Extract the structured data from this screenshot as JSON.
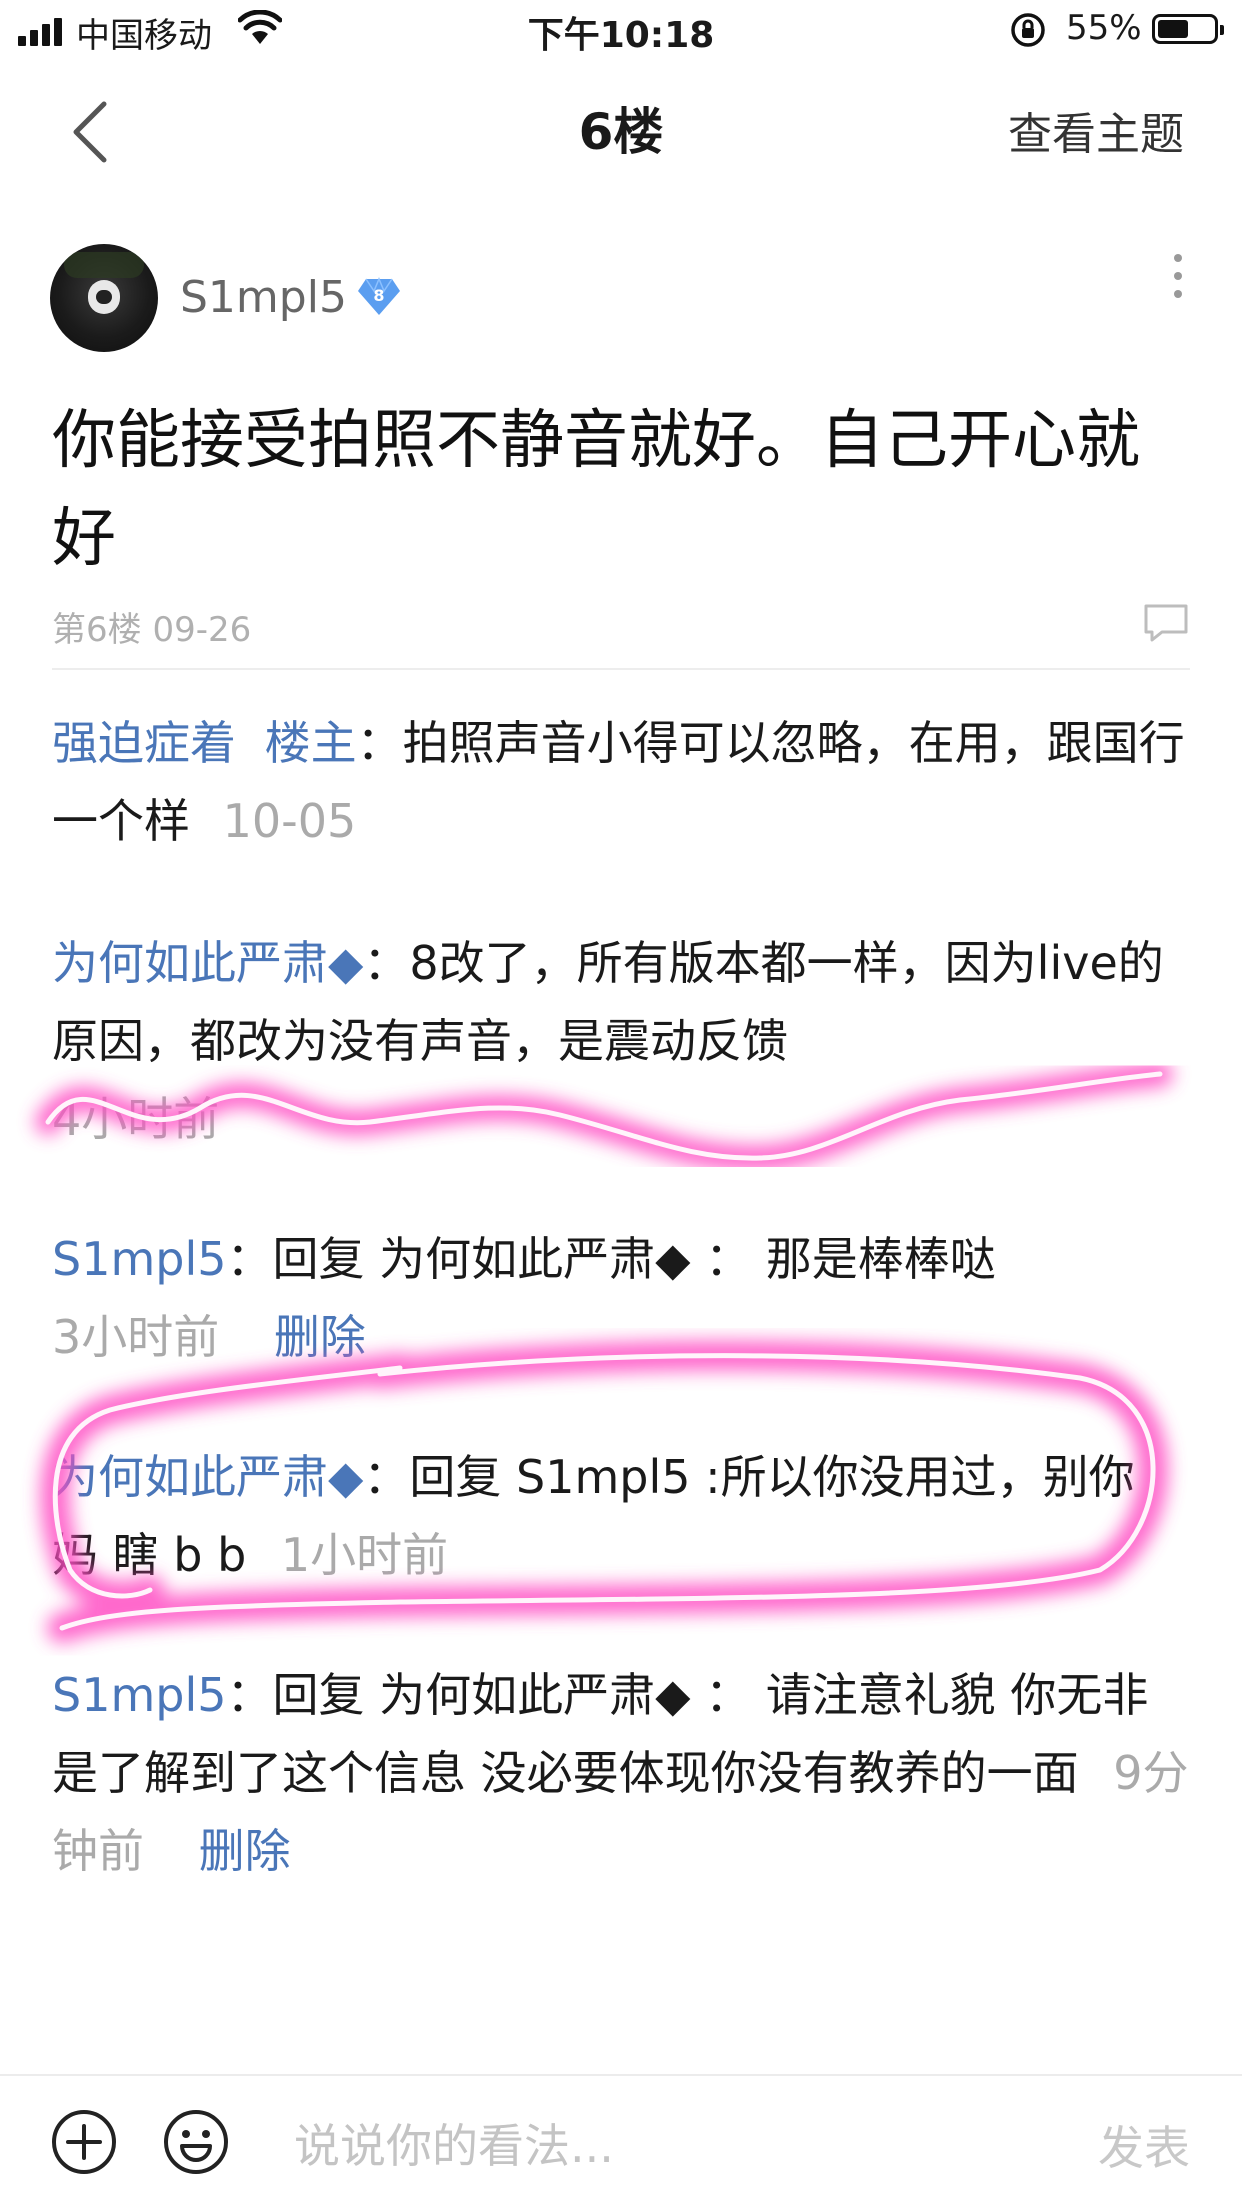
{
  "status_bar": {
    "carrier": "中国移动",
    "time": "下午10:18",
    "battery_percent": "55%",
    "battery_level": 0.55
  },
  "nav": {
    "title": "6楼",
    "right_action": "查看主题",
    "back_icon": "chevron-left-icon"
  },
  "post": {
    "author": "S1mpl5",
    "level": "8",
    "text": "你能接受拍照不静音就好。自己开心就好",
    "meta": "第6楼 09-26"
  },
  "replies": [
    {
      "name": "强迫症着",
      "tag": "楼主",
      "sep": "：",
      "text": "拍照声音小得可以忽略，在用，跟国行一个样",
      "time": "10-05"
    },
    {
      "name": "为何如此严肃◆",
      "sep": "：",
      "text": "8改了，所有版本都一样，因为live的原因，都改为没有声音，是震动反馈",
      "time": "4小时前"
    },
    {
      "name": "S1mpl5",
      "sep": "：",
      "text": "回复 为何如此严肃◆ ： 那是棒棒哒",
      "time": "3小时前",
      "delete": "删除"
    },
    {
      "name": "为何如此严肃◆",
      "sep": "：",
      "text": "回复 S1mpl5 :所以你没用过，别你 妈 瞎 b b",
      "time": "1小时前"
    },
    {
      "name": "S1mpl5",
      "sep": "：",
      "text": "回复 为何如此严肃◆ ： 请注意礼貌 你无非是了解到了这个信息 没必要体现你没有教养的一面",
      "time": "9分钟前",
      "delete": "删除"
    }
  ],
  "bottom_bar": {
    "placeholder": "说说你的看法...",
    "send_label": "发表"
  },
  "colors": {
    "link_blue": "#4a76b8",
    "badge_blue": "#5b9ef0",
    "highlight_pink": "#ff4fc4"
  }
}
